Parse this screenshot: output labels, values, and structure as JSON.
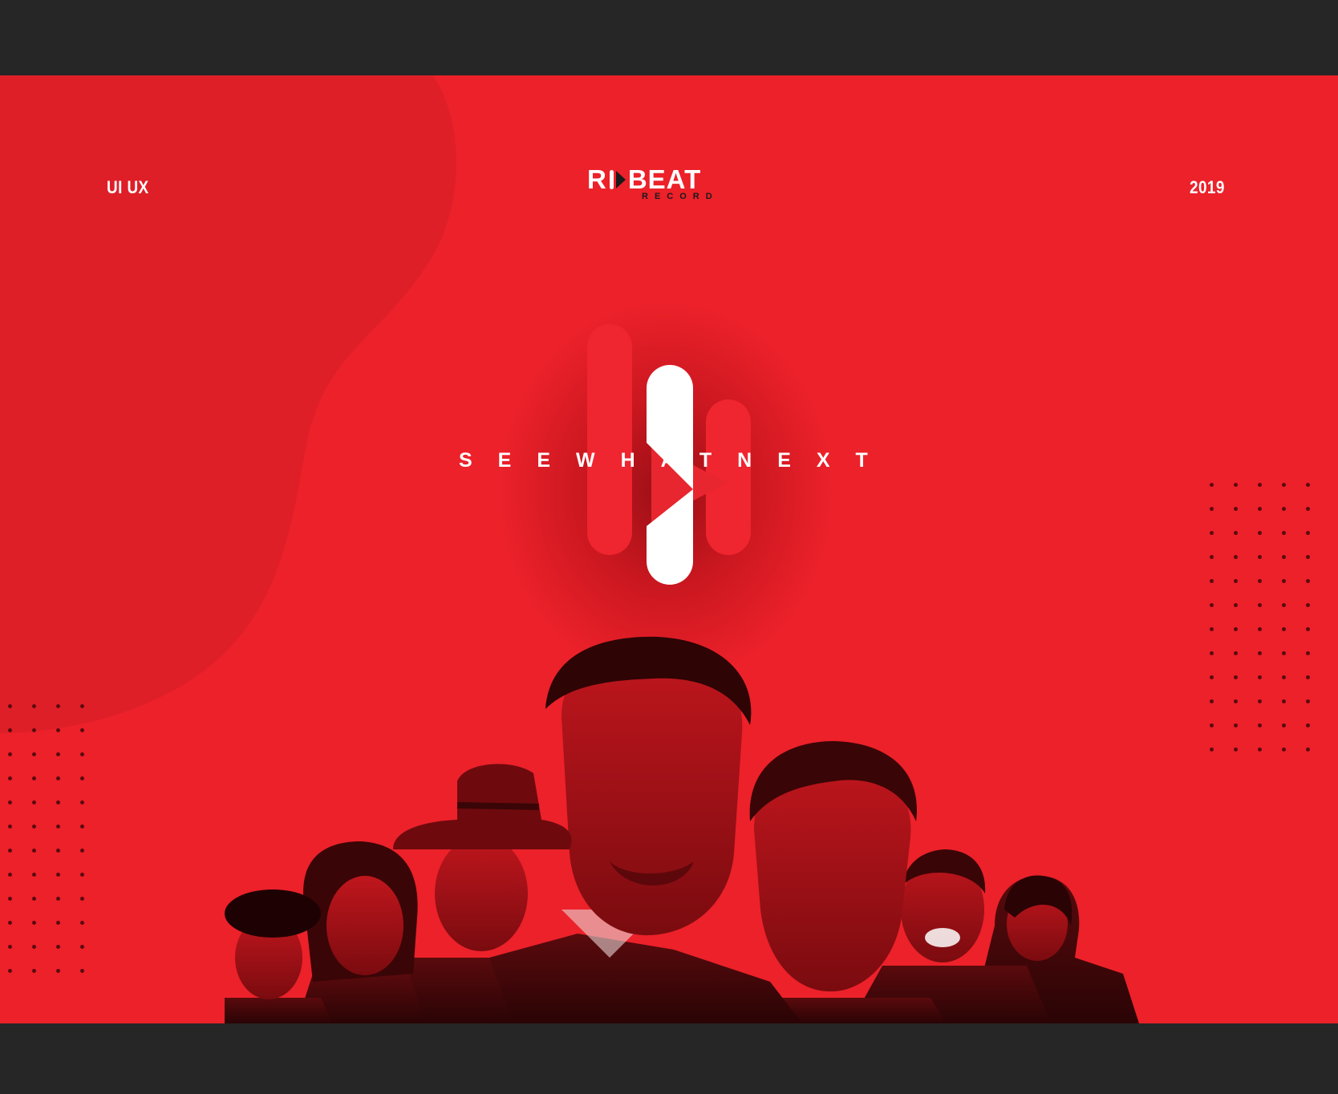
{
  "header": {
    "left_label": "UI UX",
    "right_label": "2019"
  },
  "brand": {
    "letter_r": "R",
    "word": "BEAT",
    "sub": "RECORD",
    "icon": "play-icon"
  },
  "hero": {
    "tagline_words": [
      "SEE",
      "WHAT",
      "NEXT"
    ],
    "logo_icon": "play-pill-logo-icon",
    "photo": "actors-collage-image"
  },
  "colors": {
    "background_frame": "#262626",
    "accent_red": "#ec212a",
    "dark_red_shape": "#de1f28",
    "logo_white": "#ffffff",
    "dot": "#5a0b0e"
  }
}
